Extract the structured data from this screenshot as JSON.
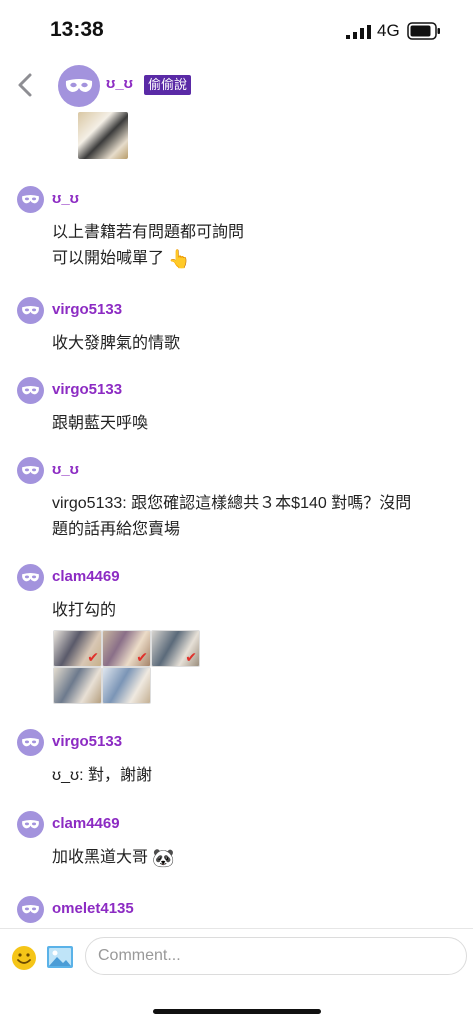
{
  "status_bar": {
    "time": "13:38",
    "network": "4G"
  },
  "header": {
    "name": "ʊ_ʊ",
    "badge": "偷偷說"
  },
  "messages": [
    {
      "user": "ʊ_ʊ",
      "lines": [
        "以上書籍若有問題都可詢問",
        "可以開始喊單了"
      ],
      "emoji": "👆"
    },
    {
      "user": "virgo5133",
      "lines": [
        "收大發脾氣的情歌"
      ]
    },
    {
      "user": "virgo5133",
      "lines": [
        "跟朝藍天呼喚"
      ]
    },
    {
      "user": "ʊ_ʊ",
      "lines": [
        "virgo5133: 跟您確認這樣總共３本$140 對嗎？沒問",
        "題的話再給您賣場"
      ]
    },
    {
      "user": "clam4469",
      "lines": [
        "收打勾的"
      ]
    },
    {
      "user": "virgo5133",
      "lines": [
        "ʊ_ʊ: 對，謝謝"
      ]
    },
    {
      "user": "clam4469",
      "lines": [
        "加收黑道大哥"
      ],
      "emoji": "🐼"
    },
    {
      "user": "omelet4135",
      "lines": []
    }
  ],
  "composer": {
    "placeholder": "Comment..."
  },
  "colors": {
    "accent": "#8c2bc3",
    "avatar": "#a393dd",
    "badge": "#5a2aa6"
  }
}
